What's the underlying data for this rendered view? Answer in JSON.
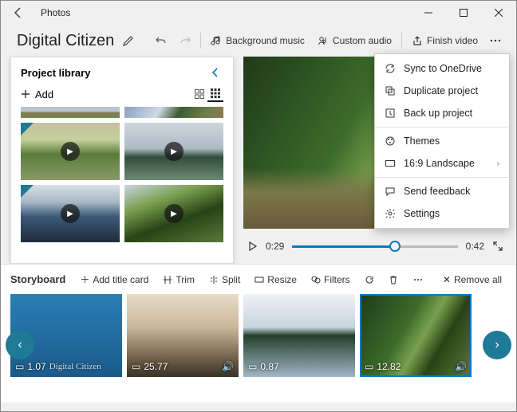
{
  "titlebar": {
    "app_name": "Photos"
  },
  "header": {
    "project_name": "Digital Citizen",
    "bg_music": "Background music",
    "custom_audio": "Custom audio",
    "finish_video": "Finish video"
  },
  "library": {
    "title": "Project library",
    "add_label": "Add"
  },
  "preview": {
    "current_time": "0:29",
    "total_time": "0:42"
  },
  "storyboard": {
    "title": "Storyboard",
    "add_title_card": "Add title card",
    "trim": "Trim",
    "split": "Split",
    "resize": "Resize",
    "filters": "Filters",
    "remove_all": "Remove all",
    "clips": [
      {
        "duration": "1.07"
      },
      {
        "duration": "25.77"
      },
      {
        "duration": "0.87"
      },
      {
        "duration": "12.82"
      }
    ]
  },
  "menu": {
    "sync": "Sync to OneDrive",
    "duplicate": "Duplicate project",
    "backup": "Back up project",
    "themes": "Themes",
    "aspect": "16:9 Landscape",
    "feedback": "Send feedback",
    "settings": "Settings"
  }
}
